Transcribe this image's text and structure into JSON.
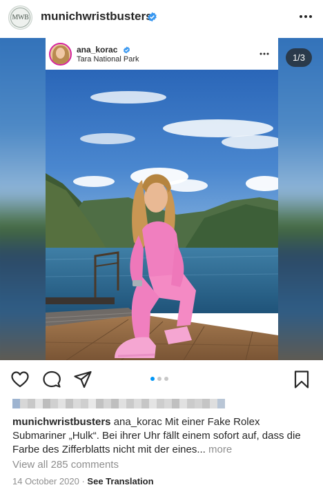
{
  "header": {
    "avatar_text": "MWB",
    "username": "munichwristbusters",
    "verified": true
  },
  "embedded_post": {
    "username": "ana_korac",
    "location": "Tara National Park",
    "verified": true
  },
  "media": {
    "counter": "1/3",
    "slide_count": 3,
    "active_slide": 1
  },
  "actions": {
    "like": "heart-icon",
    "comment": "comment-icon",
    "share": "share-icon",
    "save": "bookmark-icon"
  },
  "caption": {
    "username": "munichwristbusters",
    "text": " ana_korac  Mit einer Fake Rolex Submariner „Hulk“. Bei ihrer Uhr fällt einem sofort auf, dass die Farbe des Zifferblatts nicht mit der eines...",
    "more": " more"
  },
  "comments": {
    "label": "View all 285 comments"
  },
  "meta": {
    "date": "14 October 2020",
    "separator": " · ",
    "translate": "See Translation"
  },
  "colors": {
    "accent": "#0095f6",
    "text": "#262626",
    "muted": "#8e8e8e",
    "verified": "#3897f0"
  }
}
